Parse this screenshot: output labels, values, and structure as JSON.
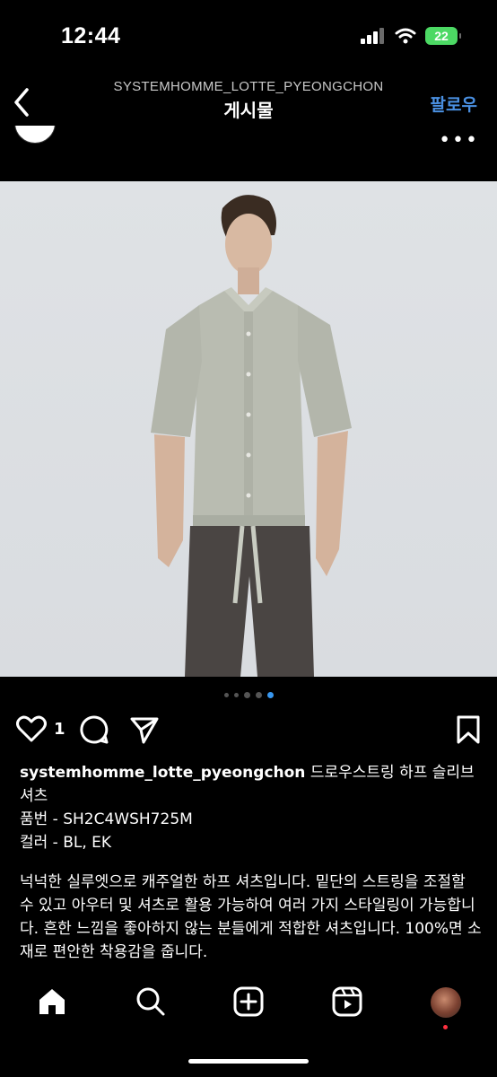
{
  "status_bar": {
    "time": "12:44",
    "battery": "22"
  },
  "nav": {
    "account": "SYSTEMHOMME_LOTTE_PYEONGCHON",
    "title": "게시물",
    "follow": "팔로우"
  },
  "post": {
    "carousel": {
      "total": 5,
      "active_index": 4
    },
    "likes": "1",
    "caption": {
      "username": "systemhomme_lotte_pyeongchon",
      "title": "드로우스트링 하프 슬리브 셔츠",
      "line1": "품번 - SH2C4WSH725M",
      "line2": "컬러 - BL, EK",
      "description": "넉넉한 실루엣으로 캐주얼한 하프 셔츠입니다. 밑단의 스트링을 조절할 수 있고 아우터 및 셔츠로 활용 가능하여 여러 가지 스타일링이 가능합니다. 흔한 느낌을 좋아하지 않는 분들에게 적합한 셔츠입니다. 100%면 소재로 편안한 착용감을 줍니다."
    }
  },
  "colors": {
    "accent": "#4a90e2",
    "carousel_active": "#3897f0",
    "battery": "#4cd964"
  },
  "icons": [
    "back-chevron-icon",
    "more-icon",
    "heart-icon",
    "comment-icon",
    "share-icon",
    "bookmark-icon",
    "home-icon",
    "search-icon",
    "create-icon",
    "reels-icon"
  ]
}
